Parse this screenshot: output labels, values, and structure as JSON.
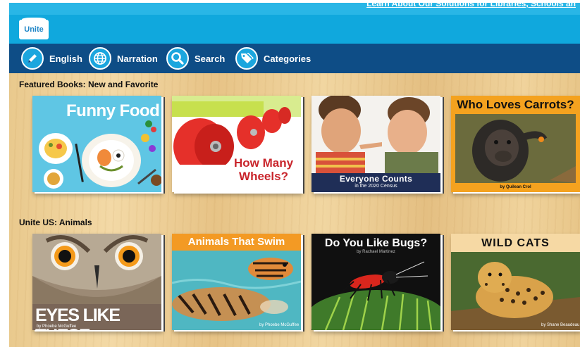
{
  "app": {
    "logo_text": "Unite",
    "top_banner_text": "Learn About Our Solutions for Libraries, Schools an"
  },
  "nav": [
    {
      "label": "English",
      "icon": "pencil-icon"
    },
    {
      "label": "Narration",
      "icon": "globe-icon"
    },
    {
      "label": "Search",
      "icon": "search-icon"
    },
    {
      "label": "Categories",
      "icon": "tags-icon"
    }
  ],
  "sections": [
    {
      "title": "Featured Books: New and Favorite",
      "books": [
        {
          "title": "Funny Food"
        },
        {
          "title": "How Many Wheels?"
        },
        {
          "title": "Everyone Counts",
          "subtitle": "in the 2020 Census"
        },
        {
          "title": "Who Loves Carrots?",
          "author": "by Quilean Crol"
        }
      ]
    },
    {
      "title": "Unite US: Animals",
      "books": [
        {
          "title": "EYES LIKE THESE",
          "author": "by Phoebe McGuffee"
        },
        {
          "title": "Animals That Swim",
          "author": "by Phoebe McGuffee"
        },
        {
          "title": "Do You Like Bugs?",
          "author": "by Rachael Martinez"
        },
        {
          "title": "WILD CATS",
          "author": "by Shane Beaudeau"
        }
      ]
    }
  ],
  "colors": {
    "accent": "#10a8dd",
    "nav": "#0e4d86",
    "frame": "#1a5a96"
  }
}
